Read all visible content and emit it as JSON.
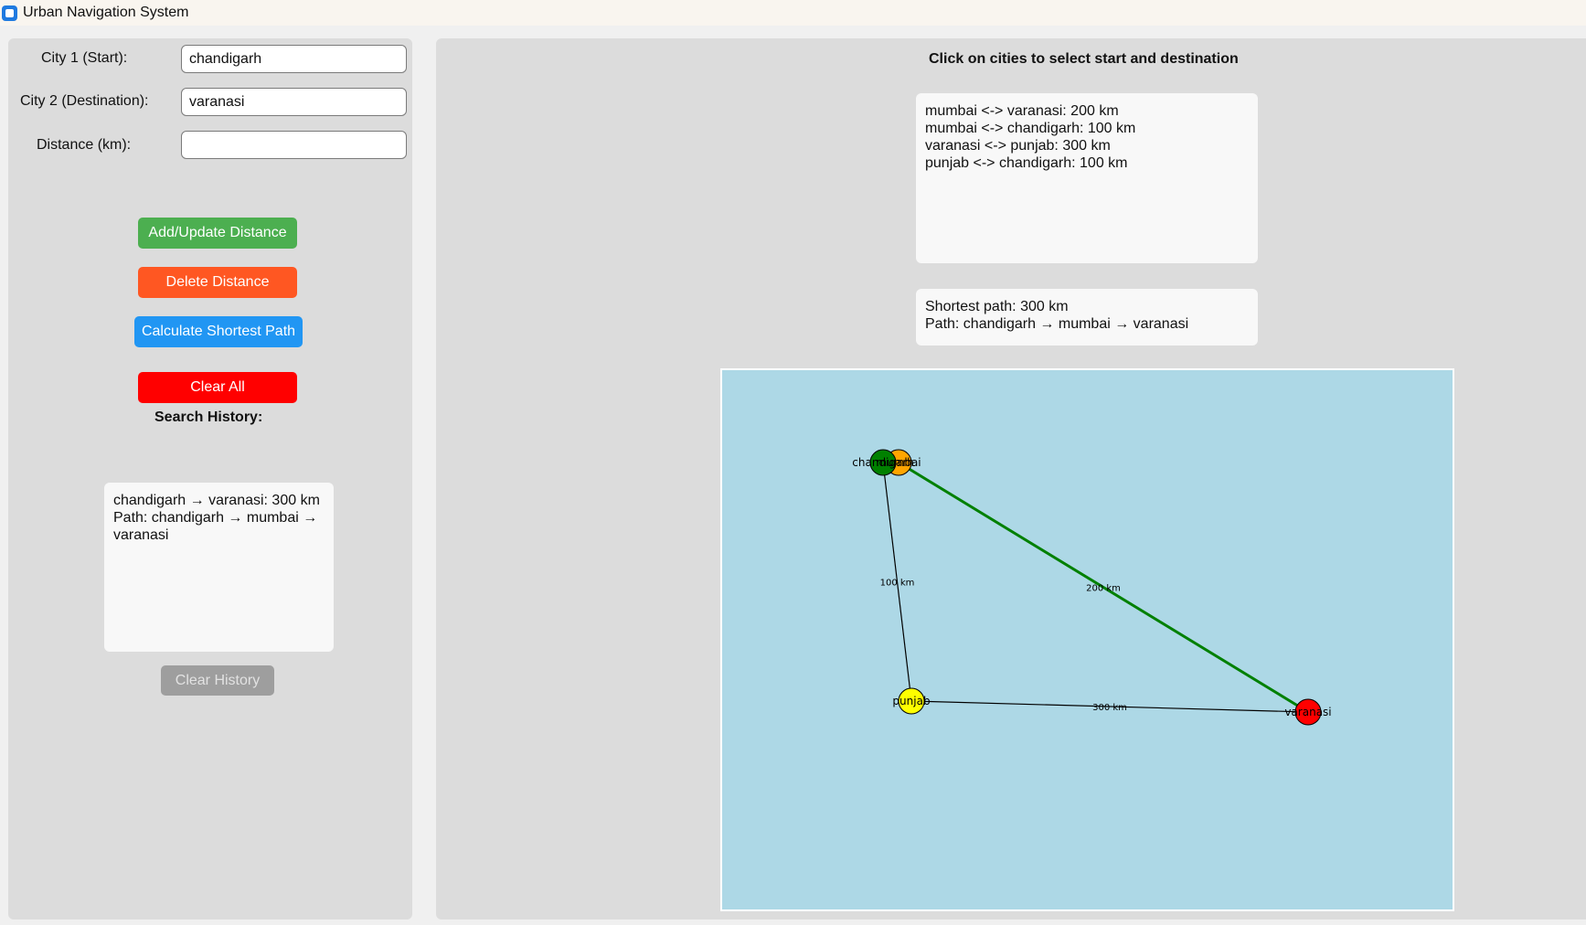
{
  "window": {
    "title": "Urban Navigation System"
  },
  "form": {
    "city1_label": "City 1 (Start):",
    "city1_value": "chandigarh",
    "city2_label": "City 2 (Destination):",
    "city2_value": "varanasi",
    "distance_label": "Distance (km):",
    "distance_value": ""
  },
  "buttons": {
    "add_update": "Add/Update Distance",
    "delete": "Delete Distance",
    "calculate": "Calculate Shortest Path",
    "clear_all": "Clear All",
    "clear_history": "Clear History"
  },
  "history": {
    "title": "Search History:",
    "entries": [
      "chandigarh → varanasi: 300 km",
      "Path: chandigarh → mumbai → varanasi"
    ]
  },
  "main": {
    "instruction": "Click on cities to select start and destination",
    "distances": [
      "mumbai <-> varanasi: 200 km",
      "mumbai <-> chandigarh: 100 km",
      "varanasi <-> punjab: 300 km",
      "punjab <-> chandigarh: 100 km"
    ],
    "result": {
      "line1": "Shortest path: 300 km",
      "line2": "Path: chandigarh → mumbai → varanasi"
    }
  },
  "graph": {
    "nodes": [
      {
        "id": "mumbai",
        "label": "mumbai",
        "color": "#ffa500"
      },
      {
        "id": "chandigarh",
        "label": "chandigarh",
        "color": "#008000"
      },
      {
        "id": "punjab",
        "label": "punjab",
        "color": "#ffff00"
      },
      {
        "id": "varanasi",
        "label": "varanasi",
        "color": "#ff0000"
      }
    ],
    "edges": [
      {
        "from": "chandigarh",
        "to": "punjab",
        "label": "100 km",
        "highlight": false
      },
      {
        "from": "mumbai",
        "to": "varanasi",
        "label": "200 km",
        "highlight": true
      },
      {
        "from": "punjab",
        "to": "varanasi",
        "label": "300 km",
        "highlight": false
      }
    ],
    "colors": {
      "highlight_edge": "#008000",
      "normal_edge": "#000000",
      "background": "#add8e6"
    }
  }
}
